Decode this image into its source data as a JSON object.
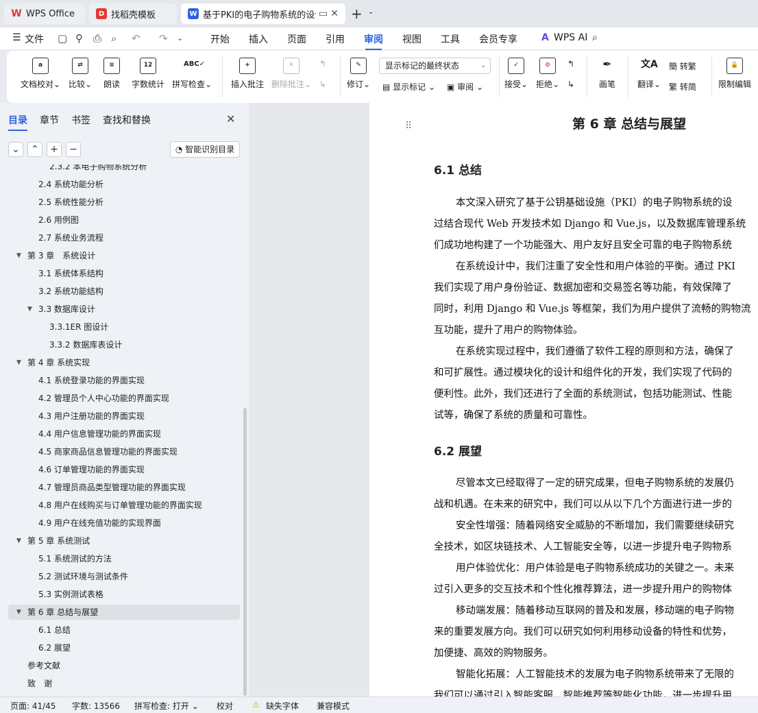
{
  "tabs": {
    "wps": "WPS Office",
    "template": "找稻壳模板",
    "doc": "基于PKI的电子购物系统的设计"
  },
  "menu": {
    "file": "文件",
    "items": [
      "开始",
      "插入",
      "页面",
      "引用",
      "审阅",
      "视图",
      "工具",
      "会员专享"
    ],
    "wps_ai": "WPS AI"
  },
  "ribbon": {
    "doc_check": "文档校对",
    "compare": "比较",
    "read": "朗读",
    "word_count": "字数统计",
    "spell_check": "拼写检查",
    "insert_comment": "插入批注",
    "delete_comment": "删除批注",
    "track": "修订",
    "markup_dropdown": "显示标记的最终状态",
    "show_markup": "显示标记",
    "review_pane": "审阅",
    "accept": "接受",
    "reject": "拒绝",
    "pen": "画笔",
    "translate": "翻译",
    "to_trad": "转繁",
    "to_simp": "转简",
    "restrict": "限制编辑"
  },
  "side": {
    "tabs": [
      "目录",
      "章节",
      "书签",
      "查找和替换"
    ],
    "smart_btn": "智能识别目录",
    "toc": [
      {
        "text": "2.3.2 本电子购物系统分析",
        "level": 3
      },
      {
        "text": "2.4 系统功能分析",
        "level": 2
      },
      {
        "text": "2.5 系统性能分析",
        "level": 2
      },
      {
        "text": "2.6 用例图",
        "level": 2
      },
      {
        "text": "2.7 系统业务流程",
        "level": 2
      },
      {
        "text": "第 3 章　系统设计",
        "level": 1
      },
      {
        "text": "3.1 系统体系结构",
        "level": 2
      },
      {
        "text": "3.2 系统功能结构",
        "level": 2
      },
      {
        "text": "3.3 数据库设计",
        "level": 2
      },
      {
        "text": "3.3.1ER 图设计",
        "level": 3
      },
      {
        "text": "3.3.2 数据库表设计",
        "level": 3
      },
      {
        "text": "第 4 章  系统实现",
        "level": 1
      },
      {
        "text": "4.1 系统登录功能的界面实现",
        "level": 2
      },
      {
        "text": "4.2 管理员个人中心功能的界面实现",
        "level": 2
      },
      {
        "text": "4.3 用户注册功能的界面实现",
        "level": 2
      },
      {
        "text": "4.4 用户信息管理功能的界面实现",
        "level": 2
      },
      {
        "text": "4.5 商家商品信息管理功能的界面实现",
        "level": 2
      },
      {
        "text": "4.6 订单管理功能的界面实现",
        "level": 2
      },
      {
        "text": "4.7 管理员商品类型管理功能的界面实现",
        "level": 2
      },
      {
        "text": "4.8 用户在线购买与订单管理功能的界面实现",
        "level": 2
      },
      {
        "text": "4.9 用户在线充值功能的实现界面",
        "level": 2
      },
      {
        "text": "第 5 章  系统测试",
        "level": 1
      },
      {
        "text": "5.1 系统测试的方法",
        "level": 2
      },
      {
        "text": "5.2 测试环境与测试条件",
        "level": 2
      },
      {
        "text": "5.3 实例测试表格",
        "level": 2
      },
      {
        "text": "第 6 章  总结与展望",
        "level": 1
      },
      {
        "text": "6.1  总结",
        "level": 2
      },
      {
        "text": "6.2  展望",
        "level": 2
      },
      {
        "text": "参考文献",
        "level": 1
      },
      {
        "text": "致　谢",
        "level": 1
      }
    ]
  },
  "doc": {
    "chapter_title": "第 6 章  总结与展望",
    "h_61": "6.1  总结",
    "p1": "本文深入研究了基于公钥基础设施（PKI）的电子购物系统的设",
    "p2": "过结合现代 Web 开发技术如 Django 和 Vue.js，以及数据库管理系统",
    "p3": "们成功地构建了一个功能强大、用户友好且安全可靠的电子购物系统",
    "p4": "在系统设计中，我们注重了安全性和用户体验的平衡。通过 PKI",
    "p5": "我们实现了用户身份验证、数据加密和交易签名等功能，有效保障了",
    "p6": "同时，利用 Django 和 Vue.js 等框架，我们为用户提供了流畅的购物流",
    "p7": "互功能，提升了用户的购物体验。",
    "p8": "在系统实现过程中，我们遵循了软件工程的原则和方法，确保了",
    "p9": "和可扩展性。通过模块化的设计和组件化的开发，我们实现了代码的",
    "p10": "便利性。此外，我们还进行了全面的系统测试，包括功能测试、性能",
    "p11": "试等，确保了系统的质量和可靠性。",
    "h_62": "6.2  展望",
    "p12": "尽管本文已经取得了一定的研究成果，但电子购物系统的发展仍",
    "p13": "战和机遇。在未来的研究中，我们可以从以下几个方面进行进一步的",
    "p14": "安全性增强：随着网络安全威胁的不断增加，我们需要继续研究",
    "p15": "全技术，如区块链技术、人工智能安全等，以进一步提升电子购物系",
    "p16": "用户体验优化：用户体验是电子购物系统成功的关键之一。未来",
    "p17": "过引入更多的交互技术和个性化推荐算法，进一步提升用户的购物体",
    "p18": "移动端发展：随着移动互联网的普及和发展，移动端的电子购物",
    "p19": "来的重要发展方向。我们可以研究如何利用移动设备的特性和优势，",
    "p20": "加便捷、高效的购物服务。",
    "p21": "智能化拓展：人工智能技术的发展为电子购物系统带来了无限的",
    "p22": "我们可以通过引入智能客服、智能推荐等智能化功能，进一步提升用"
  },
  "status": {
    "page": "页面: 41/45",
    "words": "字数: 13566",
    "spell": "拼写检查: 打开",
    "proof": "校对",
    "missing_font": "缺失字体",
    "compat": "兼容模式"
  }
}
